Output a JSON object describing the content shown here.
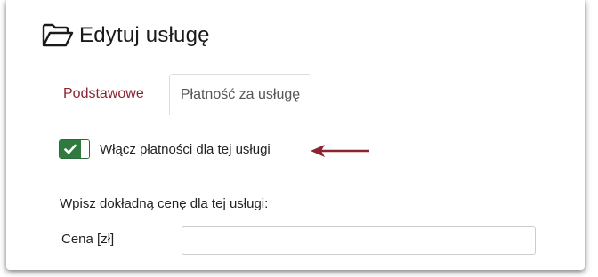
{
  "page": {
    "title": "Edytuj usługę",
    "title_icon": "folder-open-icon"
  },
  "tabs": [
    {
      "label": "Podstawowe",
      "active": false
    },
    {
      "label": "Płatność za usługę",
      "active": true
    }
  ],
  "payments_toggle": {
    "label": "Włącz płatności dla tej usługi",
    "checked": true,
    "icon": "checkmark-icon",
    "on_color": "#2f7a3f"
  },
  "annotation": {
    "icon": "arrow-left-icon",
    "color": "#8b2331"
  },
  "price_section": {
    "hint": "Wpisz dokładną cenę dla tej usługi:",
    "label": "Cena [zł]",
    "value": "",
    "placeholder": ""
  },
  "colors": {
    "accent": "#8b2331",
    "toggle_green": "#2f7a3f"
  }
}
